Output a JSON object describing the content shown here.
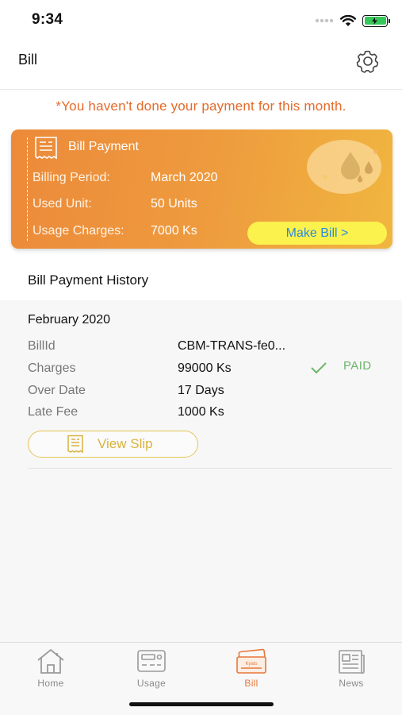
{
  "status_bar": {
    "time": "9:34"
  },
  "header": {
    "title": "Bill"
  },
  "warning": "*You haven't done your payment for this month.",
  "card": {
    "title": "Bill Payment",
    "rows": [
      {
        "label": "Billing Period:",
        "value": "March 2020"
      },
      {
        "label": "Used Unit:",
        "value": "50 Units"
      },
      {
        "label": "Usage Charges:",
        "value": "7000 Ks"
      }
    ],
    "make_bill_label": "Make Bill >"
  },
  "history": {
    "title": "Bill Payment History",
    "records": [
      {
        "month": "February 2020",
        "rows": [
          {
            "label": "BillId",
            "value": "CBM-TRANS-fe0..."
          },
          {
            "label": "Charges",
            "value": "99000 Ks"
          },
          {
            "label": "Over Date",
            "value": "17 Days"
          },
          {
            "label": "Late Fee",
            "value": "1000 Ks"
          }
        ],
        "status": "PAID",
        "view_slip_label": "View Slip"
      }
    ]
  },
  "tabbar": {
    "active": "Bill",
    "items": [
      {
        "label": "Home",
        "icon": "home-icon"
      },
      {
        "label": "Usage",
        "icon": "meter-icon"
      },
      {
        "label": "Bill",
        "icon": "bill-icon"
      },
      {
        "label": "News",
        "icon": "newspaper-icon"
      }
    ]
  },
  "colors": {
    "accent": "#e8773a",
    "warning": "#e56a2a",
    "make_bill_bg": "#fcf24e",
    "paid": "#6cb56a",
    "view_slip": "#d9b23e"
  }
}
